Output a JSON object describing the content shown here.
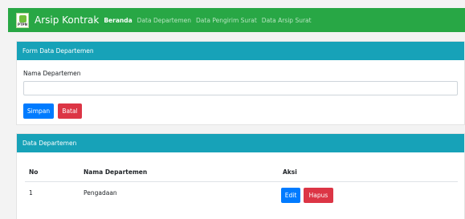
{
  "navbar": {
    "logo_text": "PTPN",
    "brand": "Arsip Kontrak",
    "links": [
      {
        "label": "Beranda",
        "active": true
      },
      {
        "label": "Data Departemen",
        "active": false
      },
      {
        "label": "Data Pengirim Surat",
        "active": false
      },
      {
        "label": "Data Arsip Surat",
        "active": false
      }
    ]
  },
  "form_card": {
    "title": "Form Data Departemen",
    "field_label": "Nama Departemen",
    "field_value": "",
    "save_label": "Simpan",
    "cancel_label": "Batal"
  },
  "table_card": {
    "title": "Data Departemen",
    "columns": [
      "No",
      "Nama Departemen",
      "Aksi"
    ],
    "rows": [
      {
        "no": "1",
        "name": "Pengadaan",
        "edit_label": "Edit",
        "delete_label": "Hapus"
      }
    ]
  },
  "colors": {
    "navbar": "#28a745",
    "card_header": "#17a2b8",
    "primary": "#007bff",
    "danger": "#dc3545"
  }
}
